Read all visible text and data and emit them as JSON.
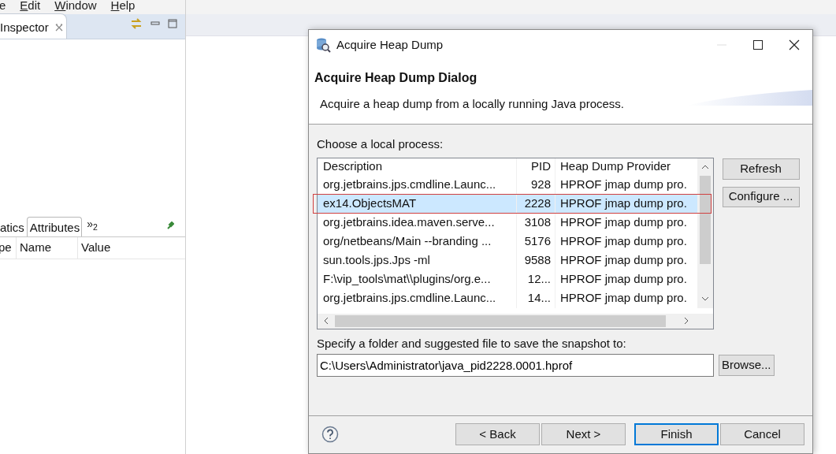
{
  "menu": [
    {
      "label": "e",
      "mnemonic": false
    },
    {
      "label": "Edit",
      "mnemonic": true
    },
    {
      "label": "Window",
      "mnemonic": true
    },
    {
      "label": "Help",
      "mnemonic": true
    }
  ],
  "inspector": {
    "tab": "Inspector"
  },
  "attributes_panel": {
    "tabs": [
      {
        "label": "atics",
        "selected": false
      },
      {
        "label": "Attributes",
        "selected": true
      }
    ],
    "overflow": {
      "glyph": "»",
      "count": "2"
    },
    "columns": [
      "pe",
      "Name",
      "Value"
    ]
  },
  "dialog": {
    "title": "Acquire Heap Dump",
    "header_title": "Acquire Heap Dump Dialog",
    "header_message": "Acquire a heap dump from a locally running Java process.",
    "process_label": "Choose a local process:",
    "table": {
      "columns": [
        "Description",
        "PID",
        "Heap Dump Provider"
      ],
      "rows": [
        {
          "cells": [
            "org.jetbrains.jps.cmdline.Launc...",
            "928",
            "HPROF jmap dump pro."
          ],
          "selected": false,
          "annotated": false
        },
        {
          "cells": [
            "ex14.ObjectsMAT",
            "2228",
            "HPROF jmap dump pro."
          ],
          "selected": true,
          "annotated": true
        },
        {
          "cells": [
            "org.jetbrains.idea.maven.serve...",
            "3108",
            "HPROF jmap dump pro."
          ],
          "selected": false,
          "annotated": false
        },
        {
          "cells": [
            "org/netbeans/Main --branding ...",
            "5176",
            "HPROF jmap dump pro."
          ],
          "selected": false,
          "annotated": false
        },
        {
          "cells": [
            "sun.tools.jps.Jps -ml",
            "9588",
            "HPROF jmap dump pro."
          ],
          "selected": false,
          "annotated": false
        },
        {
          "cells": [
            "F:\\vip_tools\\mat\\\\plugins/org.e...",
            "12...",
            "HPROF jmap dump pro."
          ],
          "selected": false,
          "annotated": false
        },
        {
          "cells": [
            "org.jetbrains.jps.cmdline.Launc...",
            "14...",
            "HPROF jmap dump pro."
          ],
          "selected": false,
          "annotated": false
        }
      ]
    },
    "side_buttons": [
      "Refresh",
      "Configure ..."
    ],
    "file_label": "Specify a folder and suggested file to save the snapshot to:",
    "file_value": "C:\\Users\\Administrator\\java_pid2228.0001.hprof",
    "browse_button": "Browse...",
    "footer_buttons": [
      {
        "label": "< Back",
        "default": false
      },
      {
        "label": "Next >",
        "default": false
      },
      {
        "label": "Finish",
        "default": true
      },
      {
        "label": "Cancel",
        "default": false
      }
    ]
  }
}
